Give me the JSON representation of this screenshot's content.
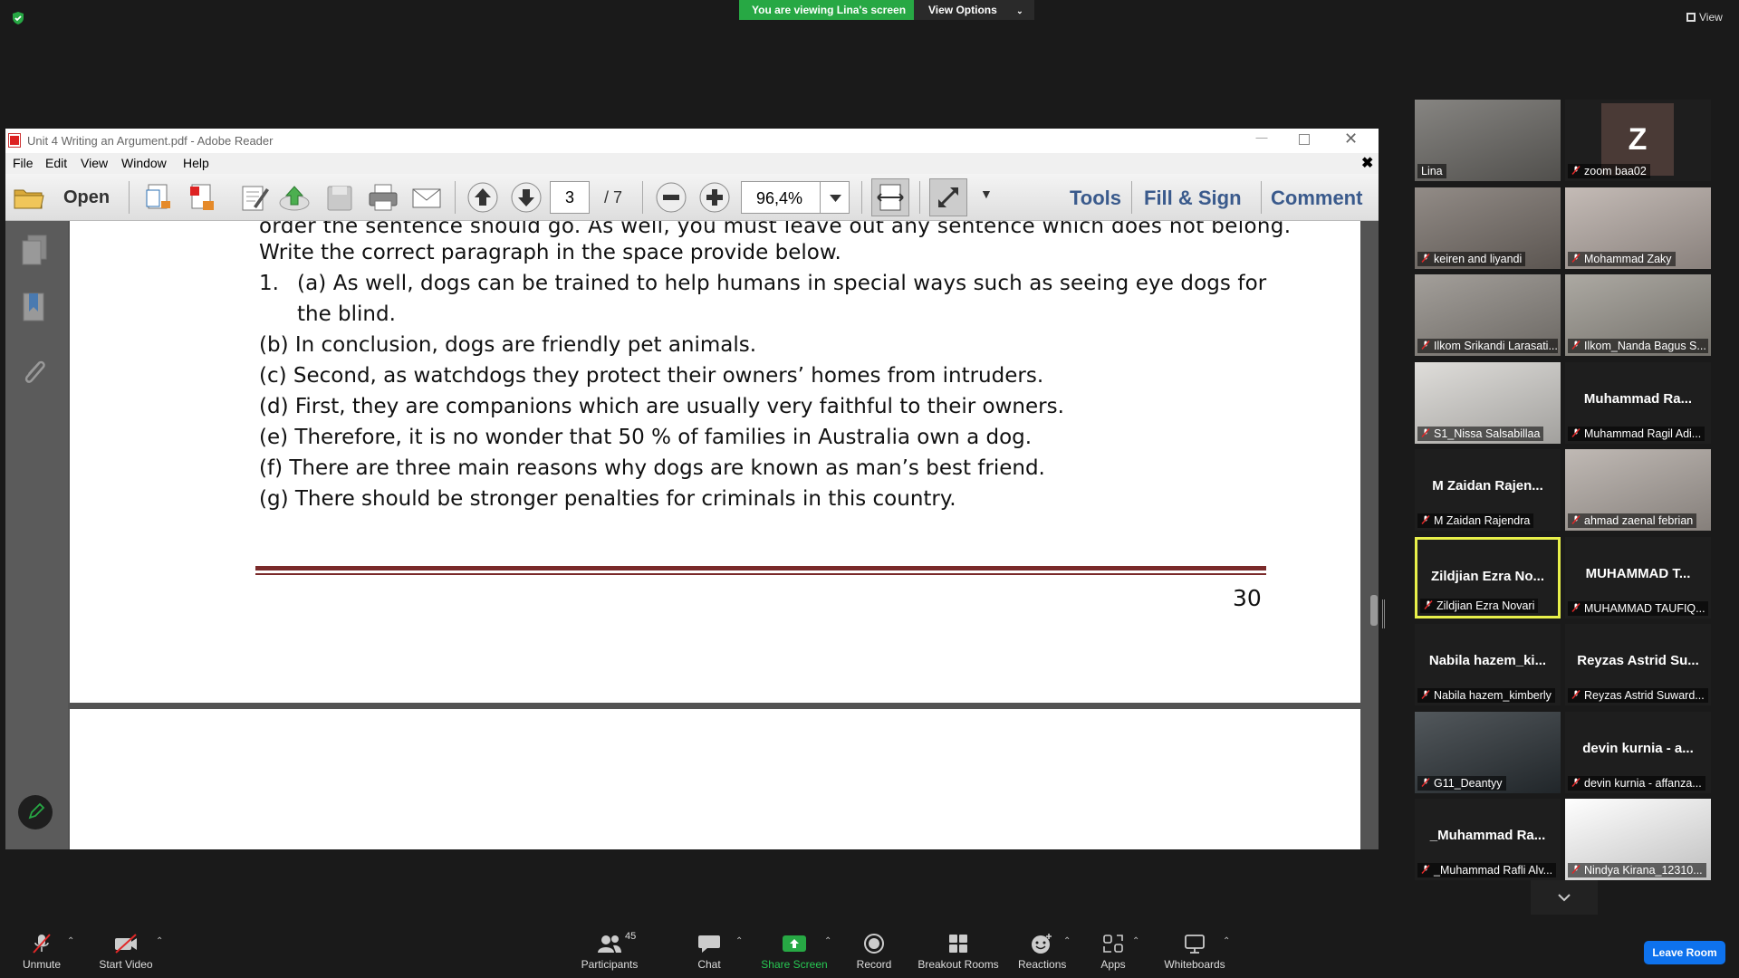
{
  "topbar": {
    "viewing_label": "You are viewing Lina's screen",
    "view_options_label": "View Options",
    "view_label": "View"
  },
  "adobe": {
    "title": "Unit 4 Writing an Argument.pdf - Adobe Reader",
    "menu": [
      "File",
      "Edit",
      "View",
      "Window",
      "Help"
    ],
    "toolbar": {
      "open_label": "Open",
      "page_current": "3",
      "page_total": "/ 7",
      "zoom": "96,4%",
      "tools_label": "Tools",
      "fill_sign_label": "Fill & Sign",
      "comment_label": "Comment"
    },
    "document": {
      "line_top": "order the sentence should go. As well, you must leave out any sentence which does not belong.",
      "line_instr": "Write the correct paragraph in the space provide below.",
      "item1_num": "1.",
      "item1_a": "(a) As well, dogs can be trained to help humans in special ways such as seeing eye   dogs for",
      "item1_a2": "the blind.",
      "item_b": "(b) In conclusion, dogs are friendly pet animals.",
      "item_c": "(c) Second, as watchdogs they protect their owners’ homes from intruders.",
      "item_d": "(d) First, they are companions which are usually very faithful to their owners.",
      "item_e": "(e) Therefore, it is no wonder that 50 % of families in Australia own a dog.",
      "item_f": "(f) There are three main reasons why dogs are known as man’s best friend.",
      "item_g": "(g) There should be stronger penalties for criminals in this country.",
      "page_number": "30"
    }
  },
  "gallery": [
    {
      "big": "",
      "name": "Lina",
      "muted": false,
      "video": true,
      "bg": "#6c6a66",
      "highlight": false
    },
    {
      "big": "Z",
      "name": "zoom baa02",
      "muted": true,
      "video": false,
      "bg": "#1e1e1e",
      "highlight": false
    },
    {
      "big": "",
      "name": "keiren and liyandi",
      "muted": true,
      "video": true,
      "bg": "#7a726c",
      "highlight": false
    },
    {
      "big": "",
      "name": "Mohammad Zaky",
      "muted": true,
      "video": true,
      "bg": "#b7aca6",
      "highlight": false
    },
    {
      "big": "",
      "name": "Ilkom Srikandi Larasati...",
      "muted": true,
      "video": true,
      "bg": "#8f8a84",
      "highlight": false
    },
    {
      "big": "",
      "name": "Ilkom_Nanda Bagus S...",
      "muted": true,
      "video": true,
      "bg": "#9a968e",
      "highlight": false
    },
    {
      "big": "",
      "name": "S1_Nissa Salsabillaa",
      "muted": true,
      "video": true,
      "bg": "#d8d6d2",
      "highlight": false
    },
    {
      "big": "Muhammad  Ra...",
      "name": "Muhammad Ragil Adi...",
      "muted": true,
      "video": false,
      "bg": "#1e1e1e",
      "highlight": false
    },
    {
      "big": "M  Zaidan  Rajen...",
      "name": "M Zaidan Rajendra",
      "muted": true,
      "video": false,
      "bg": "#1e1e1e",
      "highlight": false
    },
    {
      "big": "",
      "name": "ahmad zaenal febrian",
      "muted": true,
      "video": true,
      "bg": "#b2aaa4",
      "highlight": false
    },
    {
      "big": "Zildjian  Ezra  No...",
      "name": "Zildjian Ezra Novari",
      "muted": true,
      "video": false,
      "bg": "#1e1e1e",
      "highlight": true
    },
    {
      "big": "MUHAMMAD  T...",
      "name": "MUHAMMAD TAUFIQ...",
      "muted": true,
      "video": false,
      "bg": "#1e1e1e",
      "highlight": false
    },
    {
      "big": "Nabila  hazem_ki...",
      "name": "Nabila hazem_kimberly",
      "muted": true,
      "video": false,
      "bg": "#1e1e1e",
      "highlight": false
    },
    {
      "big": "Reyzas  Astrid  Su...",
      "name": "Reyzas Astrid Suward...",
      "muted": true,
      "video": false,
      "bg": "#1e1e1e",
      "highlight": false
    },
    {
      "big": "",
      "name": "G11_Deantyy",
      "muted": true,
      "video": true,
      "bg": "#2c3338",
      "highlight": false
    },
    {
      "big": "devin  kurnia  -  a...",
      "name": "devin kurnia - affanza...",
      "muted": true,
      "video": false,
      "bg": "#1e1e1e",
      "highlight": false
    },
    {
      "big": "_Muhammad  Ra...",
      "name": "_Muhammad Rafli Alv...",
      "muted": true,
      "video": false,
      "bg": "#1e1e1e",
      "highlight": false
    },
    {
      "big": "",
      "name": "Nindya Kirana_12310...",
      "muted": true,
      "video": true,
      "bg": "#ffffff",
      "highlight": false
    }
  ],
  "bottombar": {
    "unmute": "Unmute",
    "start_video": "Start Video",
    "participants": "Participants",
    "participants_count": "45",
    "chat": "Chat",
    "share_screen": "Share Screen",
    "record": "Record",
    "breakout_rooms": "Breakout Rooms",
    "reactions": "Reactions",
    "apps": "Apps",
    "whiteboards": "Whiteboards",
    "leave_room": "Leave Room"
  },
  "colors": {
    "share_green": "#27a844",
    "leave_blue": "#0e72ed",
    "highlight_yellow": "#e8f04a",
    "doc_rule": "#7a2a2a"
  }
}
